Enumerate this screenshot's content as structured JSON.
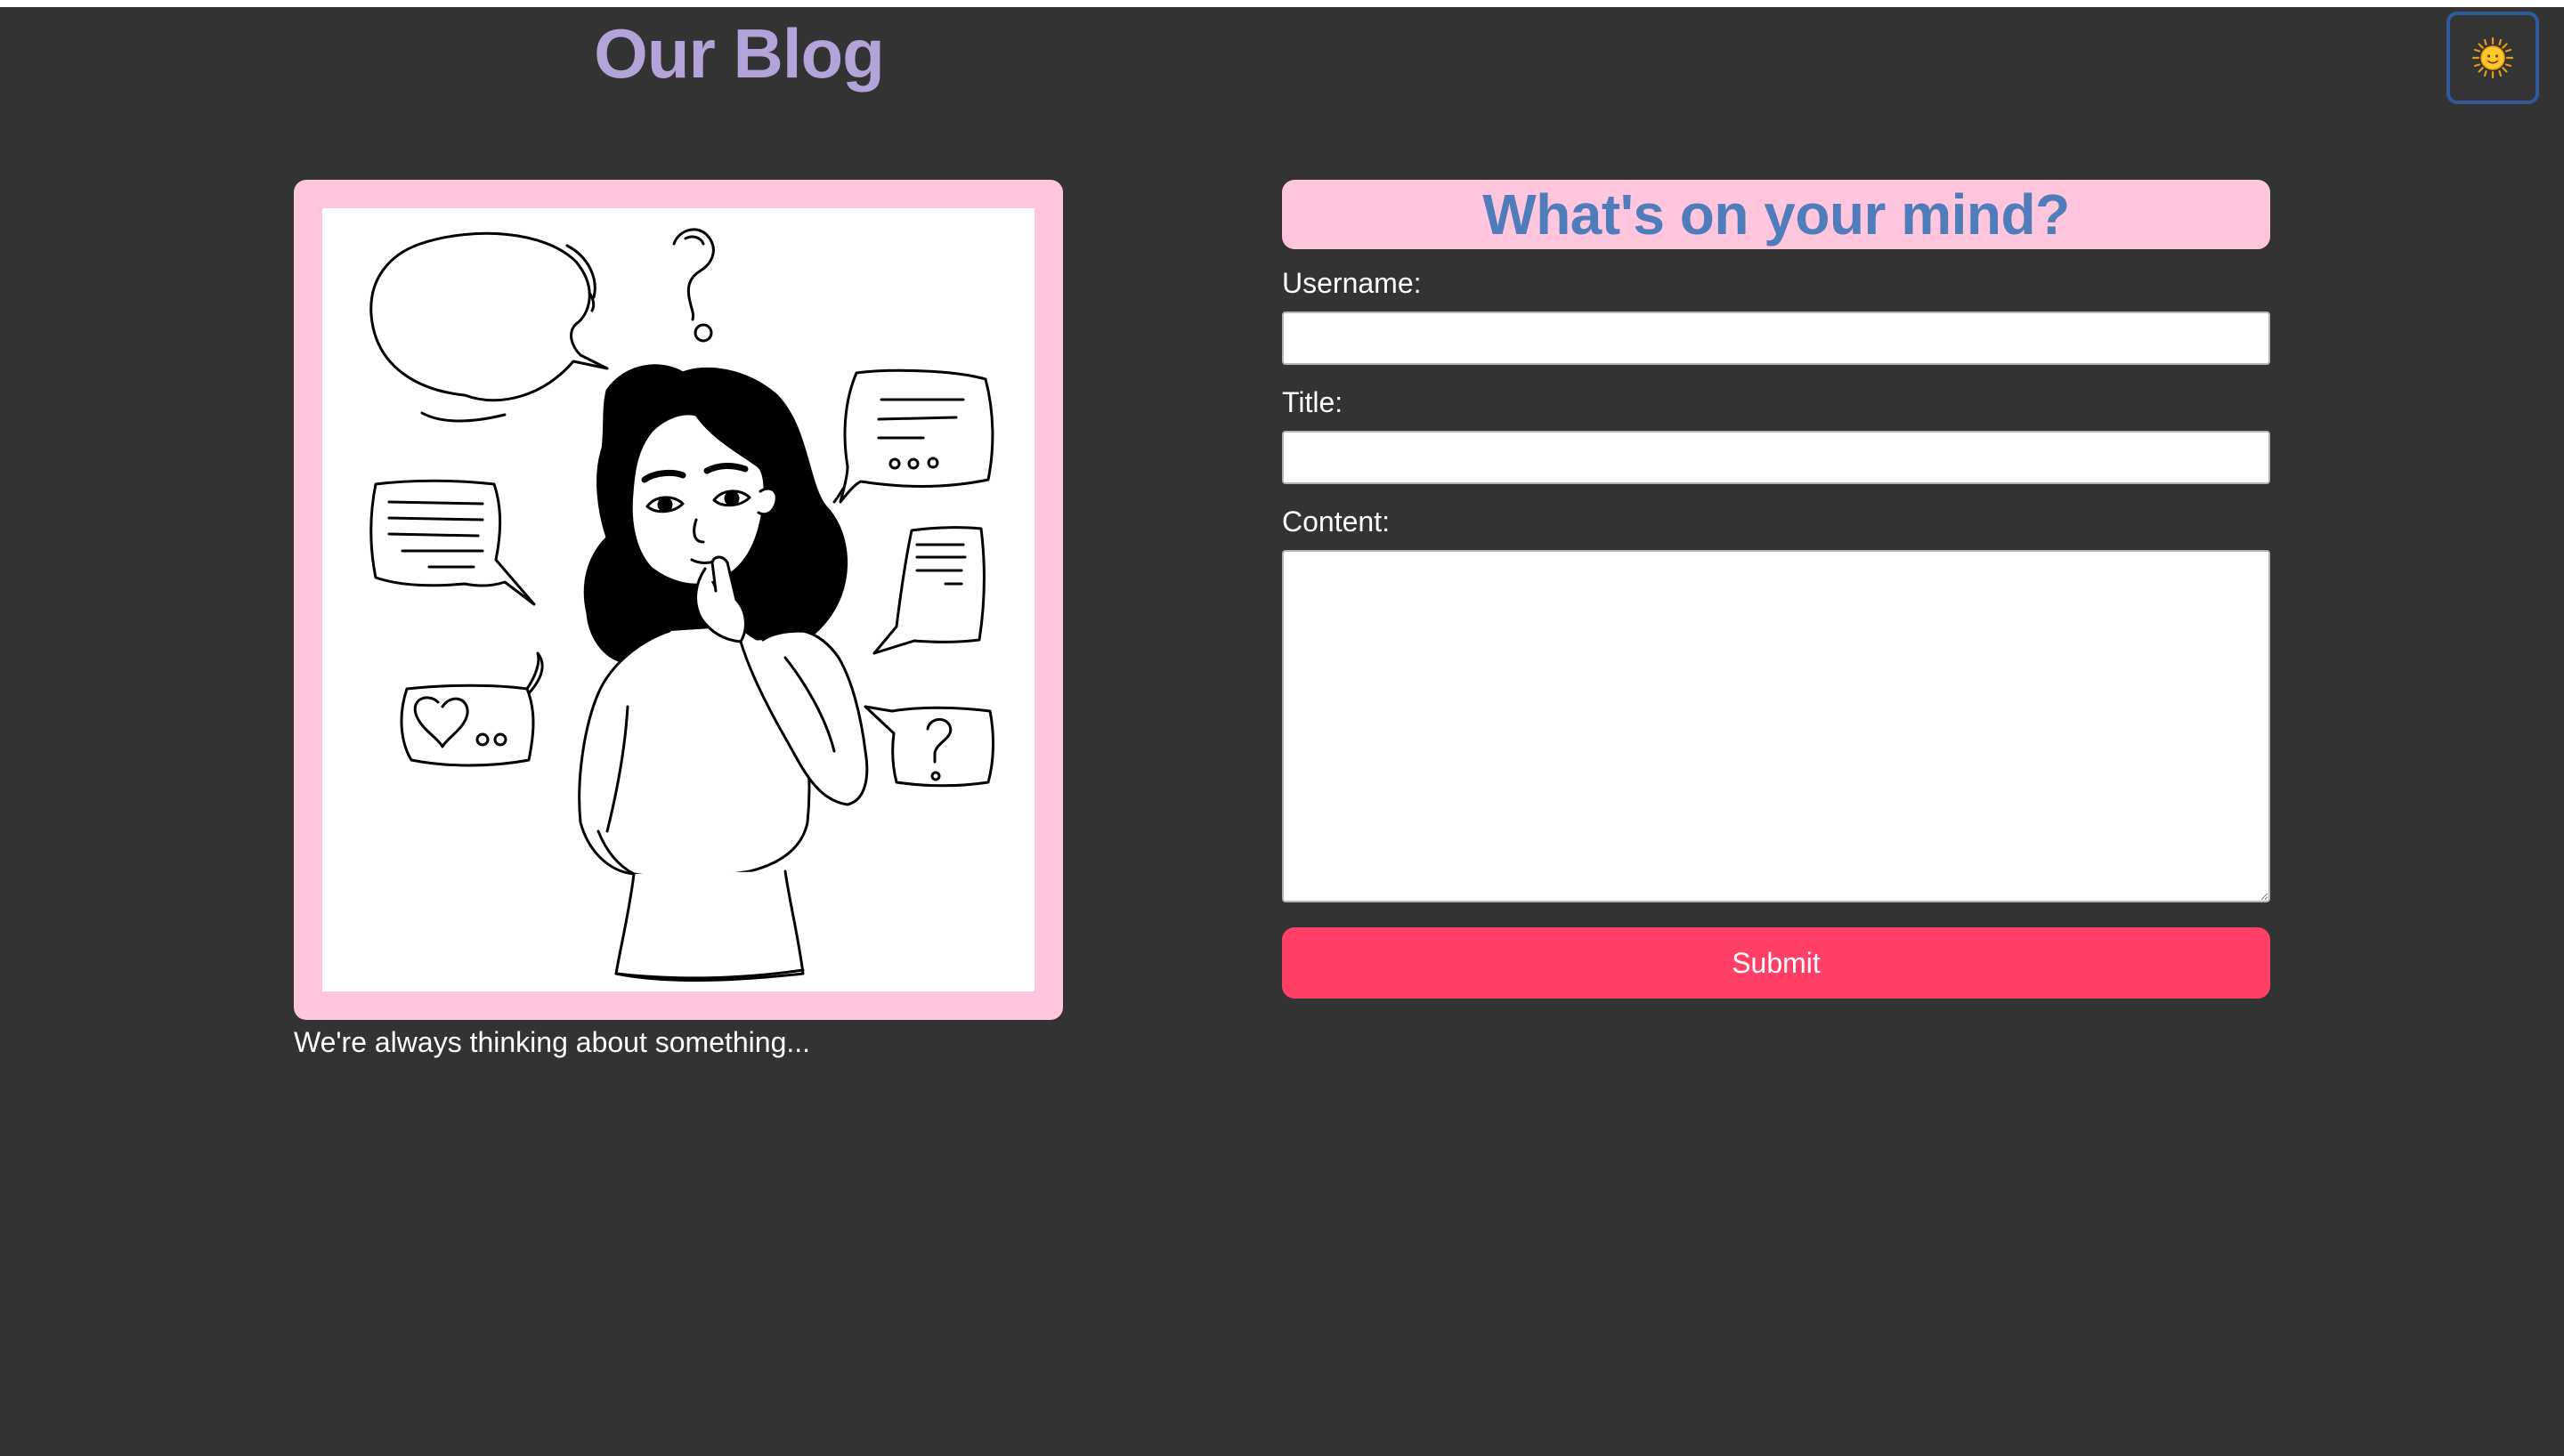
{
  "header": {
    "title": "Our Blog",
    "theme_toggle_icon": "sun-icon",
    "theme_toggle_glyph": "🌞"
  },
  "hero": {
    "image_icon": "thinking-woman-illustration",
    "caption": "We're always thinking about something..."
  },
  "form": {
    "heading": "What's on your mind?",
    "fields": {
      "username": {
        "label": "Username:",
        "value": ""
      },
      "title": {
        "label": "Title:",
        "value": ""
      },
      "content": {
        "label": "Content:",
        "value": ""
      }
    },
    "submit_label": "Submit"
  },
  "colors": {
    "page_background": "#333333",
    "site_title": "#b3a3d8",
    "frame_pink": "#ffc6dd",
    "form_heading": "#4f7cba",
    "submit_button": "#ff3f66",
    "toggle_border": "#2f5b9a"
  }
}
